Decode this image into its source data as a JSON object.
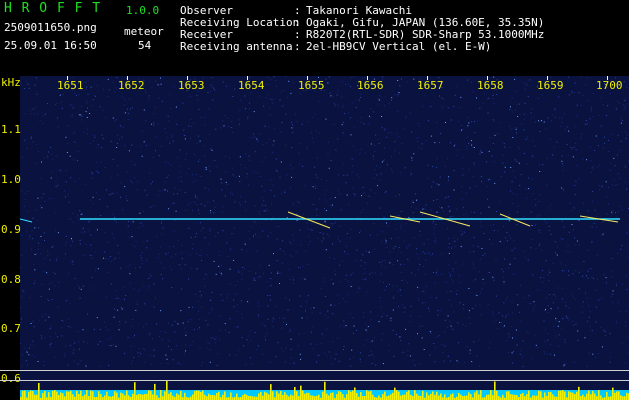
{
  "app": {
    "title": "H R O F F T",
    "version": "1.0.0",
    "filename": "2509011650.png",
    "datetime": "25.09.01 16:50",
    "meteor_label": "meteor",
    "meteor_count": "54"
  },
  "info": [
    {
      "label": "Observer",
      "value": "Takanori Kawachi"
    },
    {
      "label": "Receiving Location",
      "value": "Ogaki, Gifu, JAPAN (136.60E, 35.35N)"
    },
    {
      "label": "Receiver",
      "value": "R820T2(RTL-SDR) SDR-Sharp 53.1000MHz"
    },
    {
      "label": "Receiving antenna",
      "value": "2el-HB9CV Vertical (el. E-W)"
    }
  ],
  "time_axis": [
    "1651",
    "1652",
    "1653",
    "1654",
    "1655",
    "1656",
    "1657",
    "1658",
    "1659",
    "1700"
  ],
  "freq_axis": {
    "unit": "kHz",
    "labels": [
      "1.1",
      "1.0",
      "0.9",
      "0.8",
      "0.7",
      "0.6"
    ]
  },
  "colors": {
    "background": "#000000",
    "spectrum": "#0a1240",
    "header_green": "#20e020",
    "label_yellow": "#f0f000",
    "signal": "#30e0ff",
    "level_bar": "#f0f000",
    "noise_floor": "#00c8ff"
  }
}
